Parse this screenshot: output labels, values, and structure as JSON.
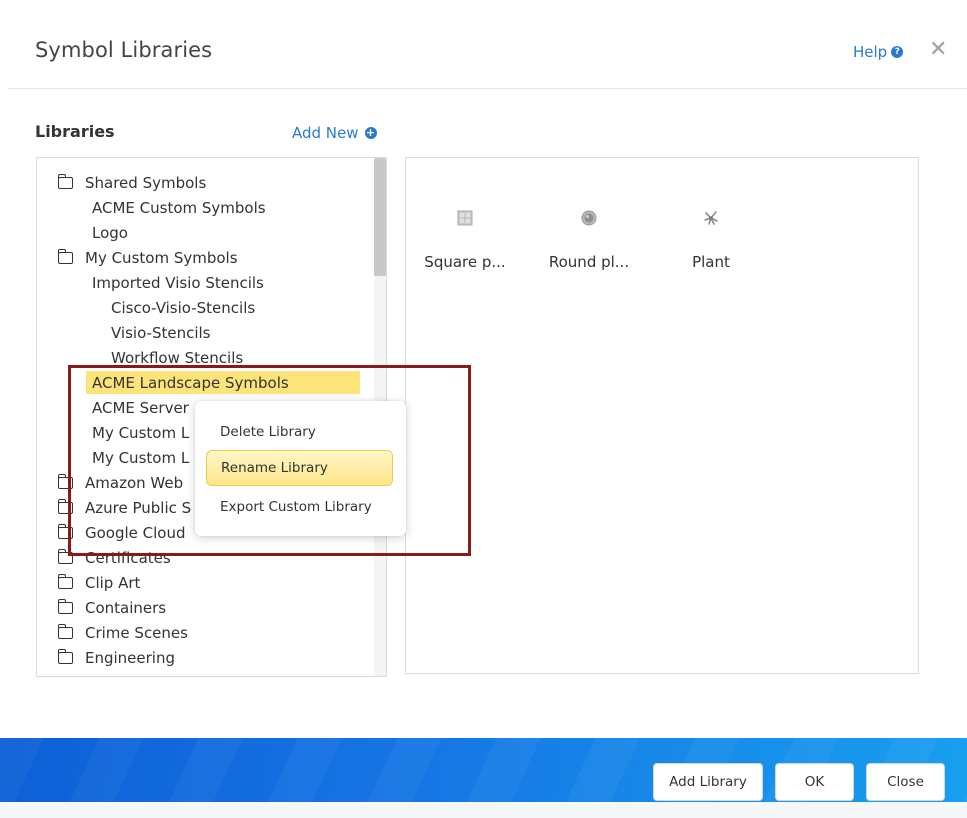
{
  "dialog": {
    "title": "Symbol Libraries",
    "help_label": "Help",
    "help_icon": "question-circle-icon",
    "close_icon": "close-icon"
  },
  "libraries": {
    "heading": "Libraries",
    "add_new_label": "Add New",
    "tree": [
      {
        "label": "Shared Symbols",
        "folder": true
      },
      {
        "label": "ACME Custom Symbols",
        "folder": false
      },
      {
        "label": "Logo",
        "folder": false
      },
      {
        "label": "My Custom Symbols",
        "folder": true
      },
      {
        "label": "Imported Visio Stencils",
        "folder": false
      },
      {
        "label": "Cisco-Visio-Stencils",
        "folder": false
      },
      {
        "label": "Visio-Stencils",
        "folder": false
      },
      {
        "label": "Workflow Stencils",
        "folder": false
      },
      {
        "label": "ACME Landscape Symbols",
        "folder": false,
        "selected": true
      },
      {
        "label": "ACME Server",
        "folder": false
      },
      {
        "label": "My Custom L",
        "folder": false
      },
      {
        "label": "My Custom L",
        "folder": false
      },
      {
        "label": "Amazon Web",
        "folder": true
      },
      {
        "label": "Azure Public S",
        "folder": true
      },
      {
        "label": "Google Cloud",
        "folder": true
      },
      {
        "label": "Certificates",
        "folder": true
      },
      {
        "label": "Clip Art",
        "folder": true
      },
      {
        "label": "Containers",
        "folder": true
      },
      {
        "label": "Crime Scenes",
        "folder": true
      },
      {
        "label": "Engineering",
        "folder": true
      }
    ]
  },
  "symbols": [
    {
      "label": "Square p...",
      "icon": "square-planter-icon"
    },
    {
      "label": "Round pl...",
      "icon": "round-planter-icon"
    },
    {
      "label": "Plant",
      "icon": "plant-icon"
    }
  ],
  "context_menu": {
    "items": [
      {
        "label": "Delete Library",
        "active": false
      },
      {
        "label": "Rename Library",
        "active": true
      },
      {
        "label": "Export Custom Library",
        "active": false
      }
    ]
  },
  "footer": {
    "add_library_label": "Add Library",
    "ok_label": "OK",
    "close_label": "Close"
  },
  "colors": {
    "accent": "#2a7ad2",
    "selection": "#fde47a",
    "highlight_border": "#8a1a1a",
    "footer_start": "#0d5fd6",
    "footer_end": "#18a0ef"
  }
}
